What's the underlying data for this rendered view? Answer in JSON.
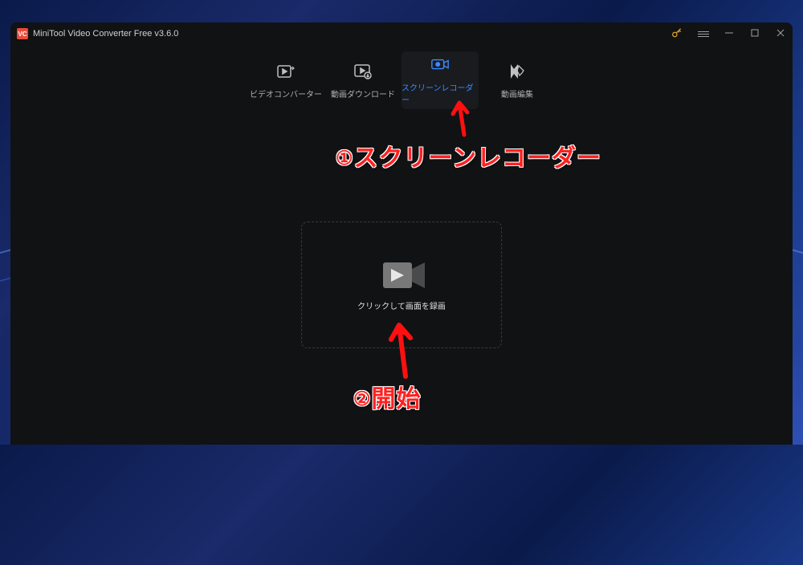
{
  "app": {
    "title": "MiniTool Video Converter Free v3.6.0",
    "logo_text": "VC"
  },
  "tabs": {
    "converter": {
      "label": "ビデオコンバーター"
    },
    "download": {
      "label": "動画ダウンロード"
    },
    "recorder": {
      "label": "スクリーンレコーダー"
    },
    "editor": {
      "label": "動画編集"
    }
  },
  "main": {
    "record_button_label": "クリックして画面を録画"
  },
  "annotations": {
    "step1_num": "①",
    "step1_text": "スクリーンレコーダー",
    "step2_num": "②",
    "step2_text": "開始"
  },
  "colors": {
    "accent": "#3a8aff",
    "annotation": "#ff2020",
    "key": "#d4a028"
  }
}
